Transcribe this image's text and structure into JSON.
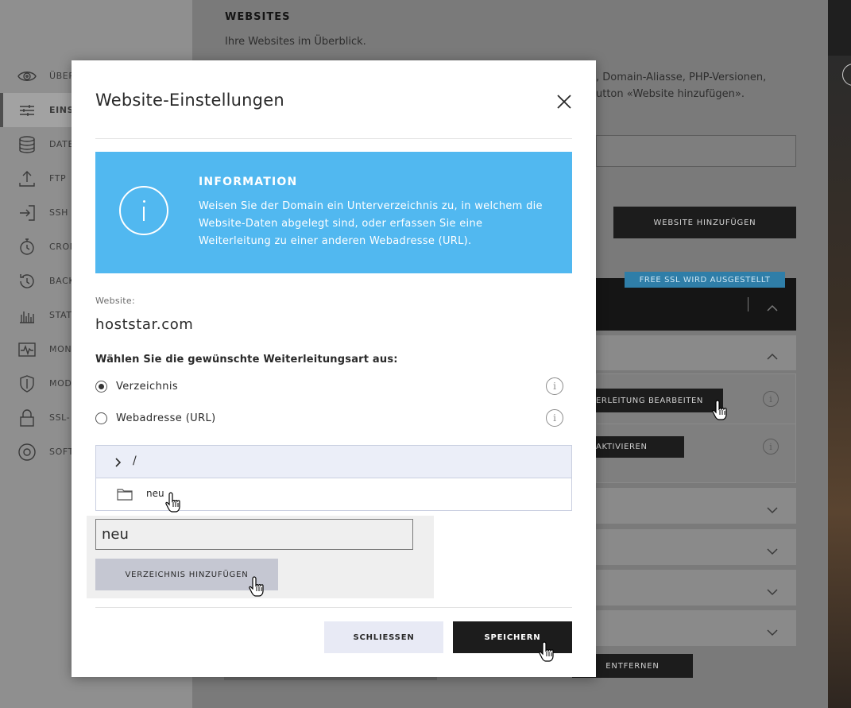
{
  "background": {
    "sidebar": {
      "items": [
        {
          "icon": "eye-icon",
          "label": "Über"
        },
        {
          "icon": "sliders-icon",
          "label": "Einst",
          "active": true
        },
        {
          "icon": "database-icon",
          "label": "Date"
        },
        {
          "icon": "upload-icon",
          "label": "FTP"
        },
        {
          "icon": "login-icon",
          "label": "SSH"
        },
        {
          "icon": "stopwatch-icon",
          "label": "Cron"
        },
        {
          "icon": "history-icon",
          "label": "Back"
        },
        {
          "icon": "stats-icon",
          "label": "Stati"
        },
        {
          "icon": "monitor-icon",
          "label": "Moni"
        },
        {
          "icon": "shield-icon",
          "label": "Mod"
        },
        {
          "icon": "lock-icon",
          "label": "SSL-"
        },
        {
          "icon": "disc-icon",
          "label": "Softv"
        }
      ]
    },
    "heading": "WEBSITES",
    "subheading": "Ihre Websites im Überblick.",
    "intro_line1": ", Domain-Aliasse, PHP-Versionen,",
    "intro_line2": "utton «Website hinzufügen».",
    "add_website_label": "WEBSITE HINZUFÜGEN",
    "ssl_badge": "FREE SSL WIRD AUSGESTELLT",
    "edit_redirect_label": "ERLEITUNG BEARBEITEN",
    "activate_label": "AKTIVIEREN",
    "remove_label": "ENTFERNEN"
  },
  "modal": {
    "title": "Website-Einstellungen",
    "info": {
      "title": "INFORMATION",
      "text": "Weisen Sie der Domain ein Unterverzeichnis zu, in welchem die Website-Daten abgelegt sind, oder erfassen Sie eine Weiterleitung zu einer anderen Webadresse (URL)."
    },
    "website_label": "Website:",
    "website_value": "hoststar.com",
    "redirect_question": "Wählen Sie die gewünschte Weiterleitungsart aus:",
    "options": [
      {
        "label": "Verzeichnis",
        "selected": true
      },
      {
        "label": "Webadresse (URL)",
        "selected": false
      }
    ],
    "directory_tree": {
      "root": "/",
      "children": [
        "neu"
      ]
    },
    "new_directory": {
      "value": "neu",
      "add_button": "VERZEICHNIS HINZUFÜGEN"
    },
    "buttons": {
      "close": "SCHLIESSEN",
      "save": "SPEICHERN"
    }
  }
}
